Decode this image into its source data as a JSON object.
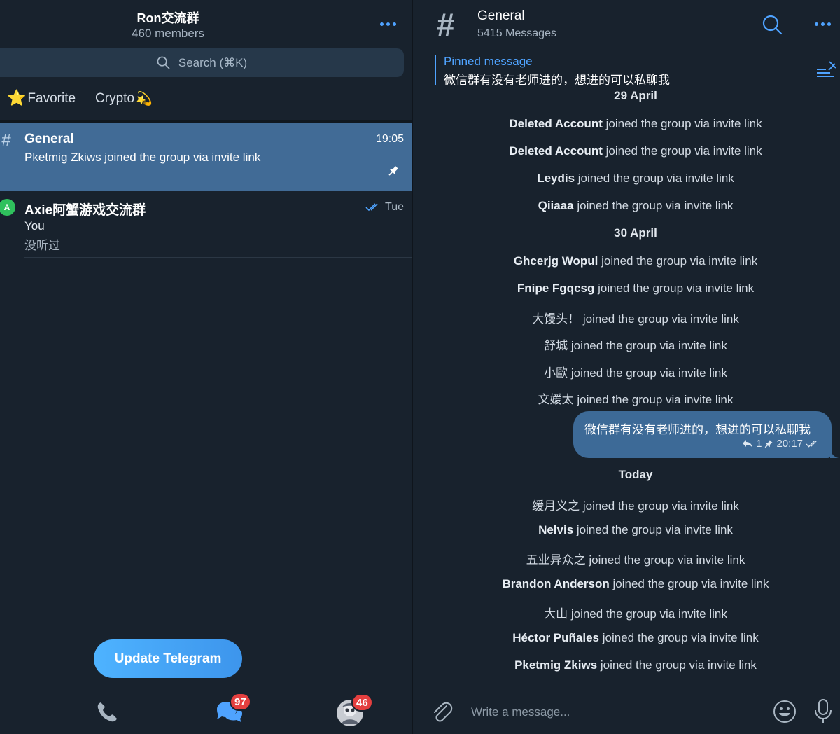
{
  "left": {
    "group_title": "Ron交流群",
    "group_subtitle": "460 members",
    "search_placeholder": "Search (⌘K)",
    "folders": [
      {
        "emoji": "⭐",
        "label": "Favorite"
      },
      {
        "label": "Crypto",
        "emoji": "💫"
      }
    ],
    "chats": [
      {
        "icon": "#",
        "name": "General",
        "time": "19:05",
        "preview": "Pketmig Zkiws joined the group via invite link",
        "pinned": true
      },
      {
        "avatar": "A",
        "name": "Axie阿蟹游戏交流群",
        "time": "Tue",
        "sender": "You",
        "preview": "没听过"
      }
    ],
    "update_button": "Update Telegram",
    "tabs": [
      {
        "icon": "phone-icon"
      },
      {
        "icon": "chats-icon",
        "badge": "97"
      },
      {
        "icon": "profile-avatar",
        "badge": "46"
      }
    ]
  },
  "right": {
    "channel_icon": "#",
    "channel_title": "General",
    "channel_subtitle": "5415 Messages",
    "pinned_label": "Pinned message",
    "pinned_text": "微信群有没有老师进的，想进的可以私聊我",
    "system_suffix": "joined the group via invite link",
    "messages": [
      {
        "type": "date",
        "text": "29 April"
      },
      {
        "type": "join",
        "name": "Deleted Account"
      },
      {
        "type": "join",
        "name": "Deleted Account"
      },
      {
        "type": "join",
        "name": "Leydis"
      },
      {
        "type": "join",
        "name": "Qiiaaa"
      },
      {
        "type": "date",
        "text": "30 April"
      },
      {
        "type": "join",
        "name": "Ghcerjg Wopul"
      },
      {
        "type": "join",
        "name": "Fnipe Fgqcsg"
      },
      {
        "type": "join",
        "name": "大馒头！"
      },
      {
        "type": "join",
        "name": "舒城"
      },
      {
        "type": "join",
        "name": "小歐"
      },
      {
        "type": "join",
        "name": "文媛太"
      },
      {
        "type": "date",
        "text": "Today"
      },
      {
        "type": "join",
        "name": "缓月义之"
      },
      {
        "type": "join",
        "name": "Nelvis"
      },
      {
        "type": "join",
        "name": "五业异众之"
      },
      {
        "type": "join",
        "name": "Brandon Anderson"
      },
      {
        "type": "join",
        "name": "大山"
      },
      {
        "type": "join",
        "name": "Héctor Puñales"
      },
      {
        "type": "join",
        "name": "Pketmig Zkiws"
      }
    ],
    "own_message": {
      "text": "微信群有没有老师进的，想进的可以私聊我",
      "replies": "1",
      "time": "20:17"
    },
    "composer_placeholder": "Write a message..."
  },
  "colors": {
    "background": "#18222d",
    "accent": "#4fa3ff",
    "active_chat": "#416b96",
    "bubble": "#3d6a97",
    "badge": "#e43f3f"
  }
}
